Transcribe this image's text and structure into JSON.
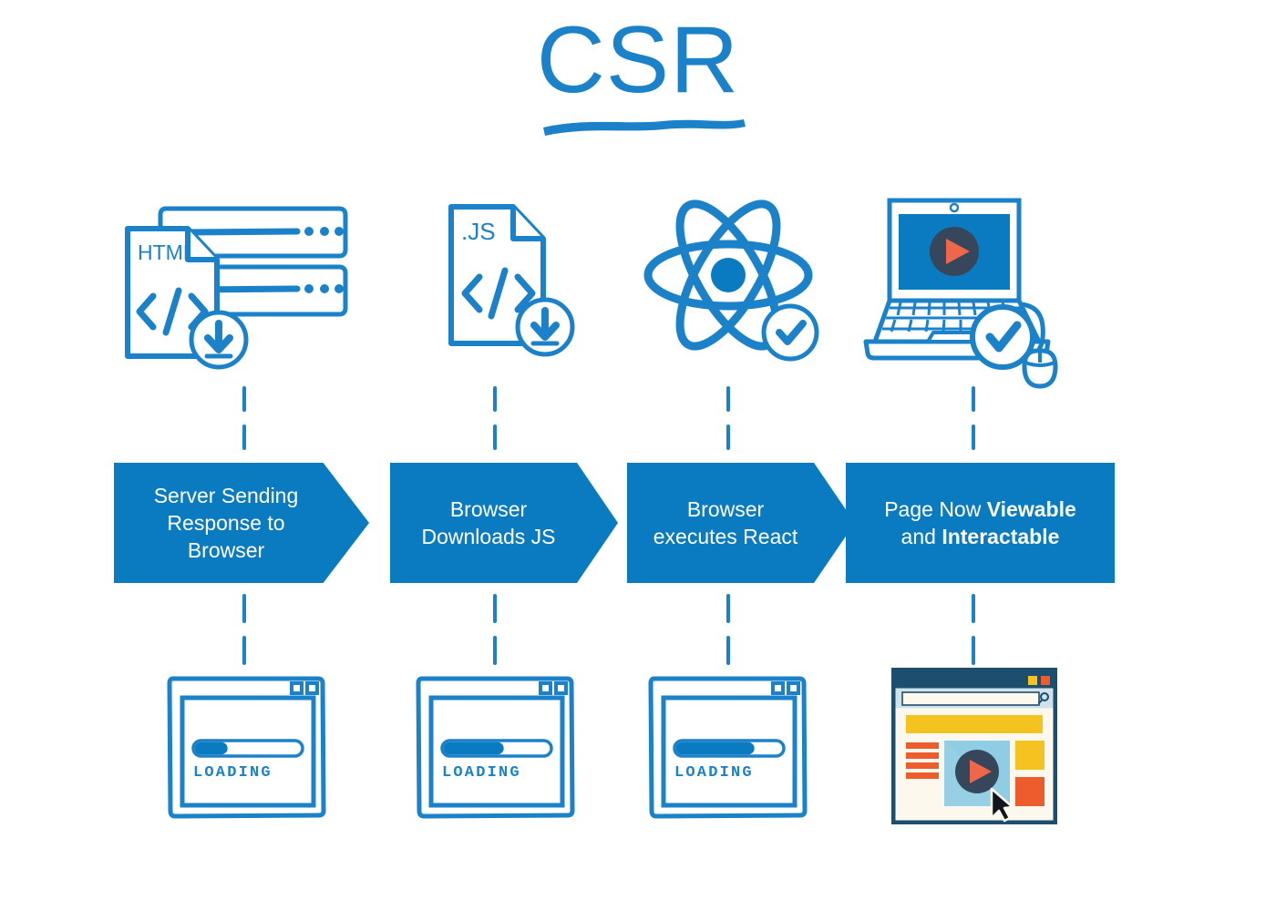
{
  "page": {
    "title": "CSR",
    "background": "#ffffff",
    "accent_blue": "#0b7bc1",
    "title_blue": "#1b82c9",
    "dark_navy": "#36475c",
    "orange": "#ef674a",
    "orange_strong": "#ec5c2c",
    "yellow": "#f5c320",
    "light_blue": "#8ecde3",
    "frame_navy": "#1d4e6e"
  },
  "steps": [
    {
      "id": "step-1",
      "icon_name": "server-html-download-icon",
      "icon_labels": {
        "doc_label": "HTML",
        "code_glyph": "</>"
      },
      "banner": {
        "line1": "Server Sending",
        "line2": "Response to Browser",
        "shape": "arrow"
      },
      "result": {
        "type": "loading-window",
        "label": "LOADING",
        "progress": 30
      }
    },
    {
      "id": "step-2",
      "icon_name": "js-file-download-icon",
      "icon_labels": {
        "doc_label": ".JS",
        "code_glyph": "</>"
      },
      "banner": {
        "line1": "Browser",
        "line2": "Downloads JS",
        "shape": "arrow"
      },
      "result": {
        "type": "loading-window",
        "label": "LOADING",
        "progress": 55
      }
    },
    {
      "id": "step-3",
      "icon_name": "react-atom-check-icon",
      "icon_labels": {
        "doc_label": "",
        "code_glyph": ""
      },
      "banner": {
        "line1": "Browser",
        "line2": "executes React",
        "shape": "arrow"
      },
      "result": {
        "type": "loading-window",
        "label": "LOADING",
        "progress": 72
      }
    },
    {
      "id": "step-4",
      "icon_name": "laptop-video-mouse-check-icon",
      "icon_labels": {
        "doc_label": "",
        "code_glyph": ""
      },
      "banner": {
        "line1_a": "Page Now ",
        "line1_b": "Viewable",
        "line2_a": "and ",
        "line2_b": "Interactable",
        "shape": "rect"
      },
      "result": {
        "type": "rendered-page"
      }
    }
  ]
}
